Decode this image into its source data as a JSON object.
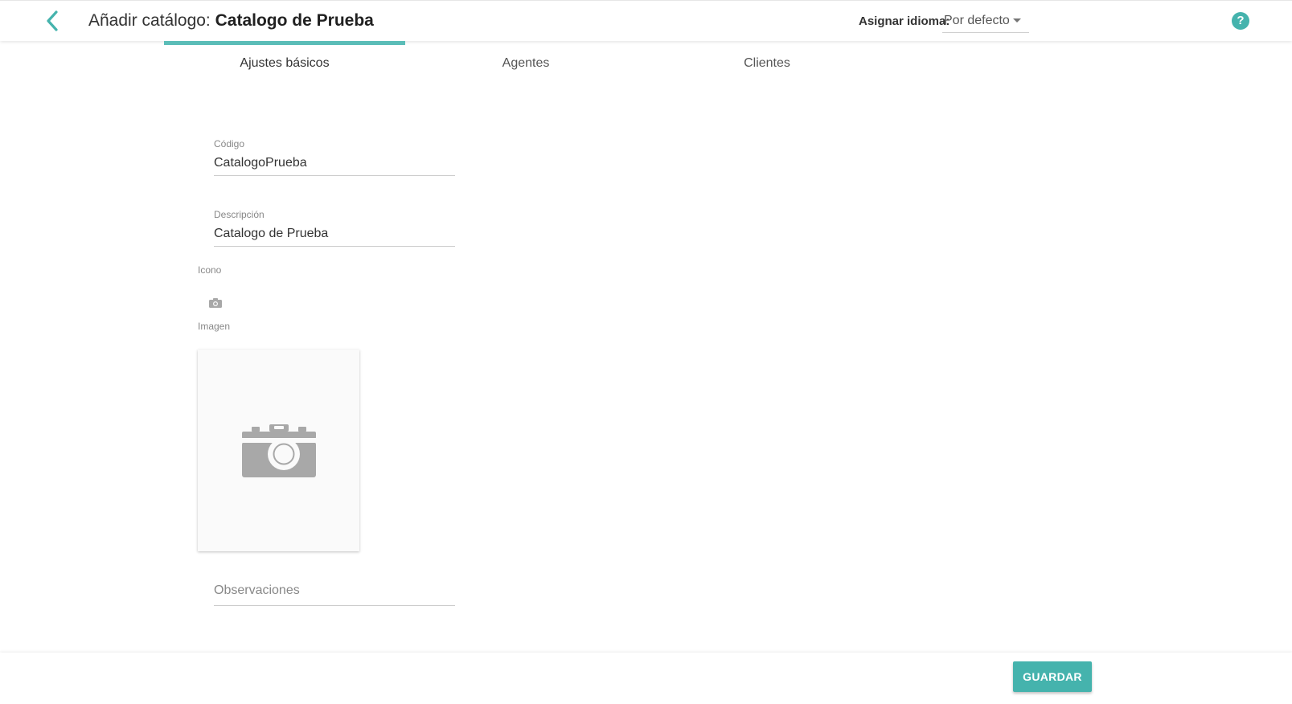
{
  "header": {
    "title_prefix": "Añadir catálogo:",
    "title_name": "Catalogo de Prueba",
    "language_label": "Asignar idioma:",
    "language_value": "Por defecto",
    "help_symbol": "?"
  },
  "tabs": [
    {
      "label": "Ajustes básicos",
      "active": true
    },
    {
      "label": "Agentes",
      "active": false
    },
    {
      "label": "Clientes",
      "active": false
    }
  ],
  "form": {
    "code": {
      "label": "Código",
      "value": "CatalogoPrueba"
    },
    "description": {
      "label": "Descripción",
      "value": "Catalogo de Prueba"
    },
    "icon_label": "Icono",
    "image_label": "Imagen",
    "observations_placeholder": "Observaciones"
  },
  "footer": {
    "save_label": "GUARDAR"
  },
  "colors": {
    "accent": "#45b3ad",
    "tab_indicator": "#5bbdb8",
    "placeholder_icon": "#a8a8a8"
  },
  "icons": {
    "back": "chevron-left-icon",
    "help": "help-circle-icon",
    "icon_upload": "camera-icon",
    "image_placeholder": "camera-icon"
  }
}
